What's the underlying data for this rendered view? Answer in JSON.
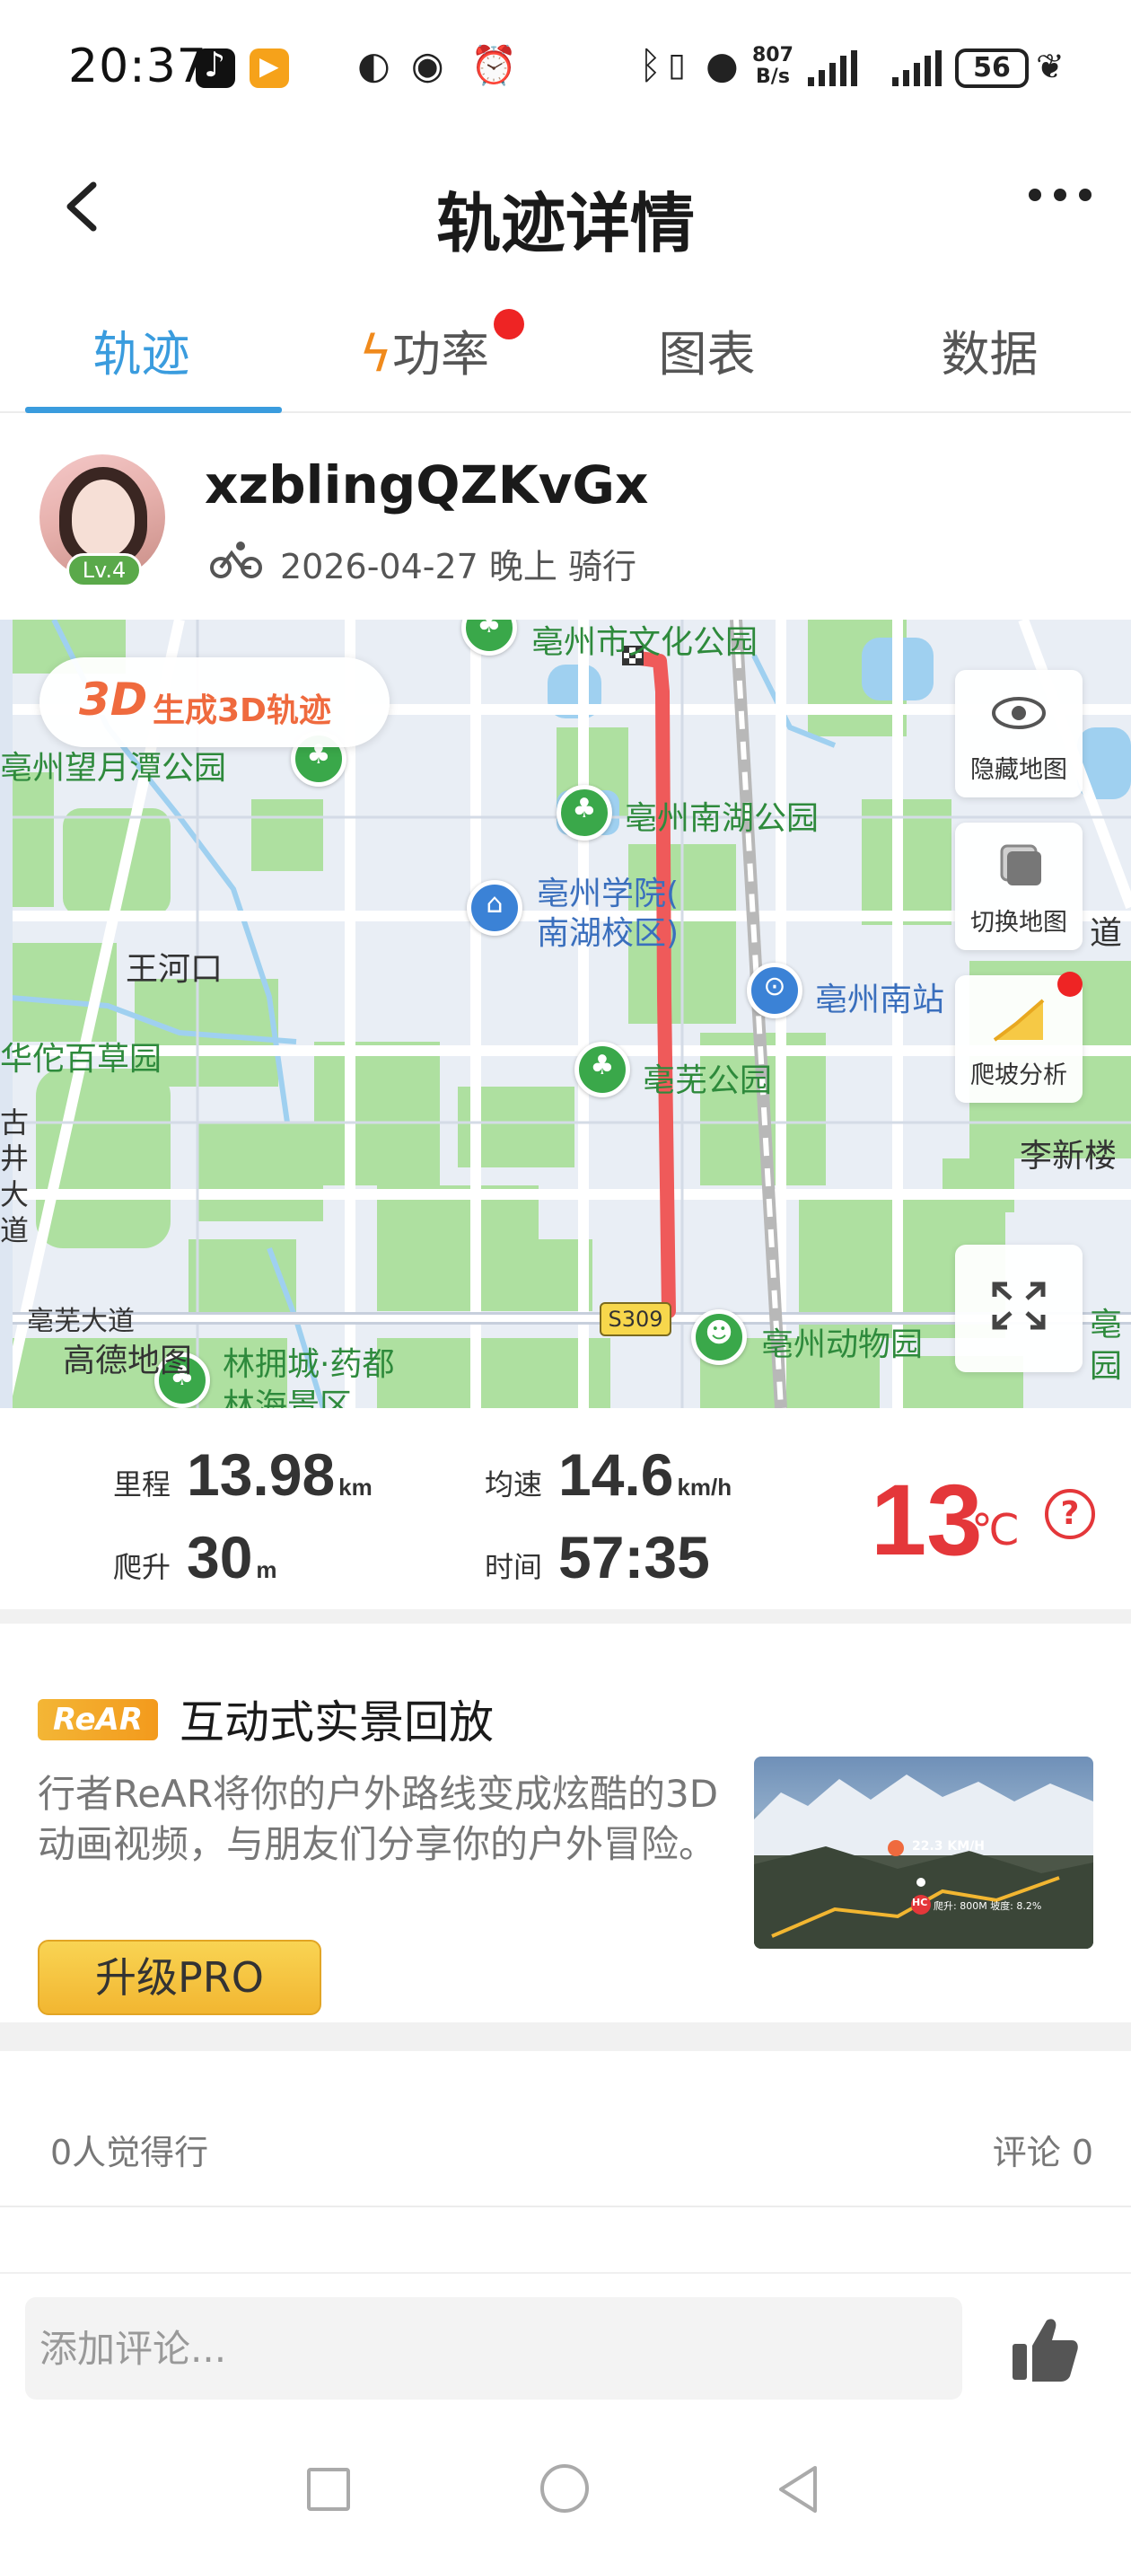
{
  "status_bar": {
    "time": "20:37",
    "net_speed_value": "807",
    "net_speed_unit": "B/s",
    "battery": "56",
    "icons": [
      "tiktok-icon",
      "play-icon",
      "vpn-icon",
      "eye-icon",
      "alarm-icon",
      "bluetooth-icon",
      "vibrate-icon",
      "location-icon",
      "signal-icon",
      "battery-icon"
    ]
  },
  "header": {
    "title": "轨迹详情"
  },
  "tabs": [
    {
      "label": "轨迹",
      "active": true
    },
    {
      "label": "功率",
      "active": false,
      "badge": true
    },
    {
      "label": "图表",
      "active": false
    },
    {
      "label": "数据",
      "active": false
    }
  ],
  "user": {
    "name": "xzblingQZKvGx",
    "level": "Lv.4",
    "ride_info": "2026-04-27 晚上 骑行"
  },
  "map": {
    "btn_3d_mark": "3D",
    "btn_3d_label": "生成3D轨迹",
    "controls": {
      "hide": "隐藏地图",
      "switch": "切换地图",
      "climb": "爬坡分析"
    },
    "labels": {
      "culture_park": "亳州市文化公园",
      "wangyuetan_park": "亳州望月潭公园",
      "nanhu_park": "亳州南湖公园",
      "college_line1": "亳州学院(",
      "college_line2": "南湖校区)",
      "wanghekou": "王河口",
      "huatuo_garden": "华佗百草园",
      "south_station": "亳州南站",
      "bowu_park": "亳芜公园",
      "lixinlou": "李新楼",
      "gujing_road": "古井大道",
      "bowu_road": "亳芜大道",
      "road_s309": "S309",
      "zoo": "亳州动物园",
      "gaode": "高德地图",
      "linyongcheng_line1": "林拥城·药都",
      "linyongcheng_line2": "林海景区",
      "right_edge_1": "亳",
      "right_edge_2": "园",
      "right_edge_3": "道"
    },
    "route_color": "#ef5a5a"
  },
  "stats": {
    "distance_label": "里程",
    "distance_value": "13.98",
    "distance_unit": "km",
    "speed_label": "均速",
    "speed_value": "14.6",
    "speed_unit": "km/h",
    "climb_label": "爬升",
    "climb_value": "30",
    "climb_unit": "m",
    "time_label": "时间",
    "time_value": "57:35",
    "temperature": "13",
    "temperature_unit": "℃",
    "help_mark": "?"
  },
  "rear": {
    "logo": "ReAR",
    "title": "互动式实景回放",
    "description": "行者ReAR将你的户外路线变成炫酷的3D动画视频，与朋友们分享你的户外冒险。",
    "upgrade_label": "升级PRO",
    "thumb_speed": "22.3 KM/H",
    "thumb_badge": "HC",
    "thumb_stats": "爬升: 800M  坡度: 8.2%"
  },
  "social": {
    "likes_text": "0人觉得行",
    "comments_text": "评论 0"
  },
  "comment": {
    "placeholder": "添加评论..."
  },
  "colors": {
    "accent_blue": "#3a9cde",
    "temperature_red": "#e4373a",
    "badge_red": "#ee2424",
    "brand_orange": "#ef6a3e",
    "pro_yellow": "#f2b631"
  }
}
